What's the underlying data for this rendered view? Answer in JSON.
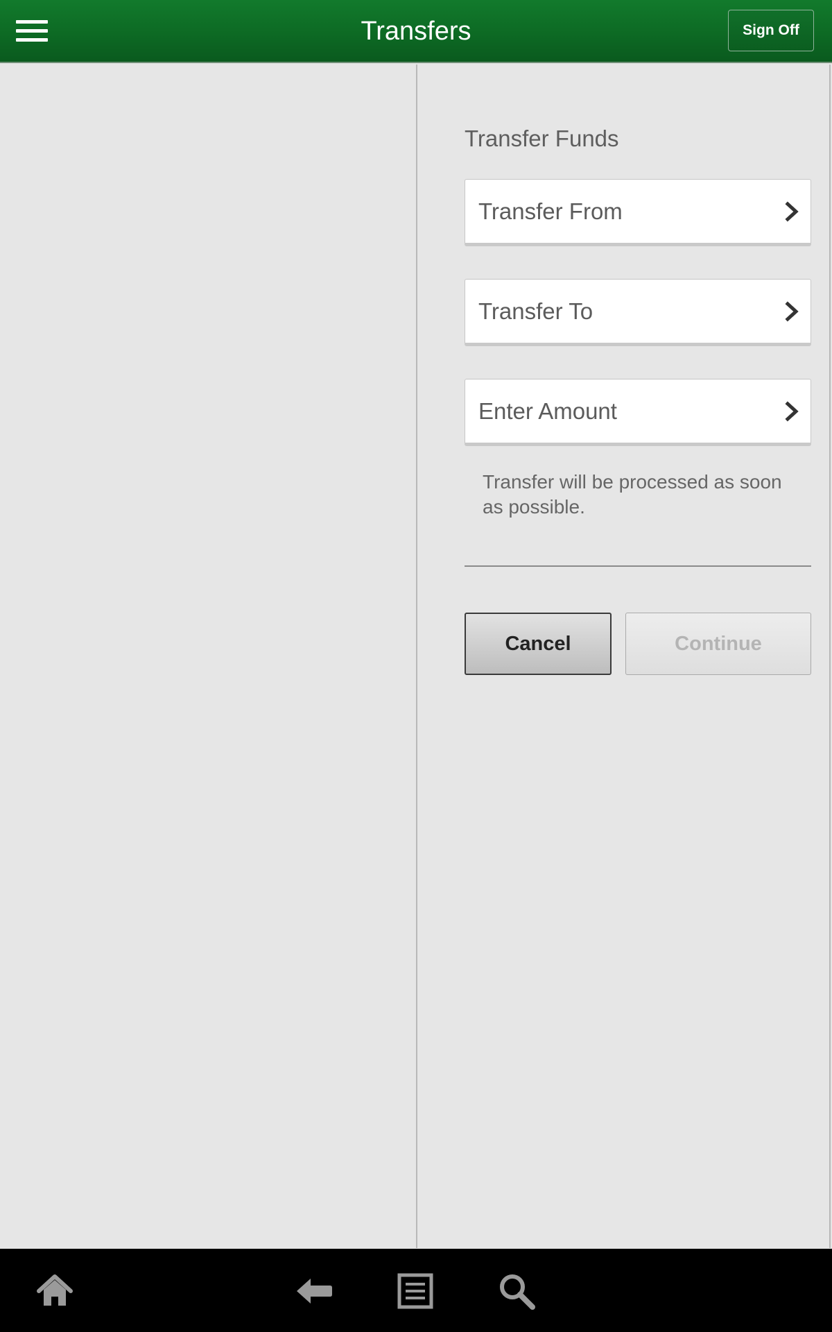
{
  "header": {
    "title": "Transfers",
    "sign_off_label": "Sign Off",
    "menu_icon": "hamburger-menu-icon",
    "background_color": "#0d6a24"
  },
  "transfer_form": {
    "section_title": "Transfer Funds",
    "rows": [
      {
        "label": "Transfer From",
        "icon": "chevron-right-icon"
      },
      {
        "label": "Transfer To",
        "icon": "chevron-right-icon"
      },
      {
        "label": "Enter Amount",
        "icon": "chevron-right-icon"
      }
    ],
    "note": "Transfer will be processed as soon as possible.",
    "cancel_label": "Cancel",
    "continue_label": "Continue",
    "continue_disabled": true
  },
  "bottom_nav": {
    "items": [
      {
        "icon": "home-icon"
      },
      {
        "icon": "back-arrow-icon"
      },
      {
        "icon": "recent-apps-icon"
      },
      {
        "icon": "search-icon"
      }
    ]
  }
}
